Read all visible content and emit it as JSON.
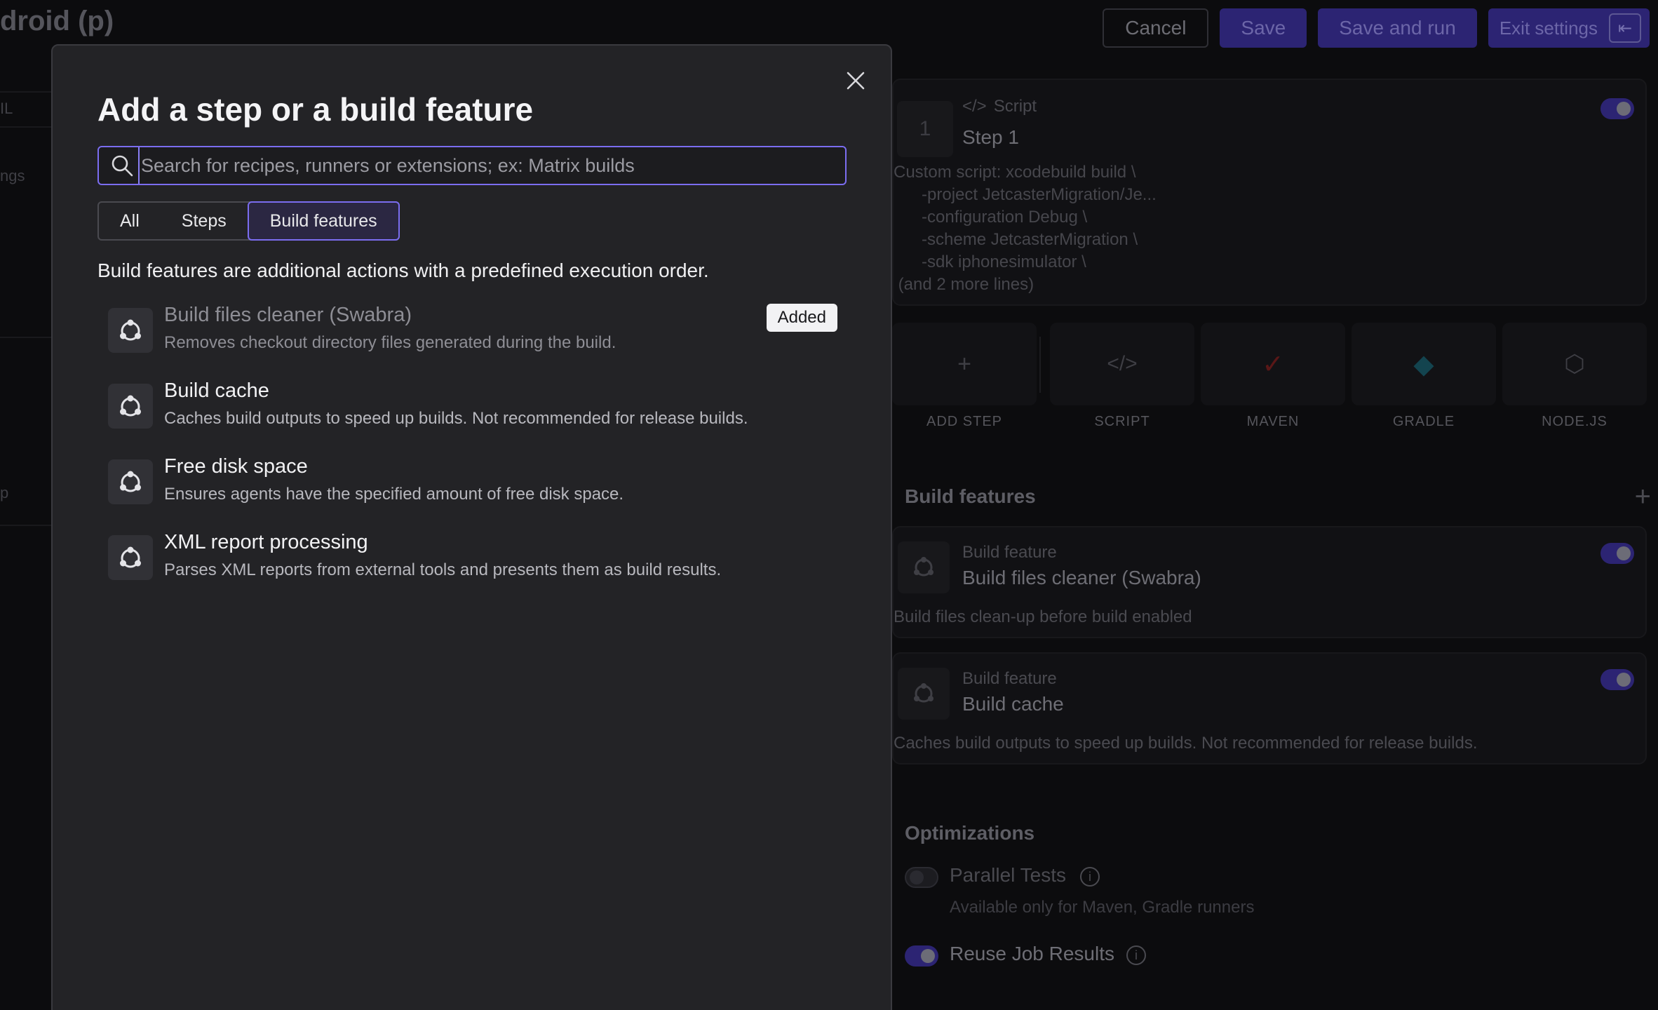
{
  "page": {
    "title": "droid (p)",
    "actions": {
      "cancel": "Cancel",
      "save": "Save",
      "save_and_run": "Save and run",
      "exit_settings": "Exit settings"
    },
    "left_fragments": [
      "IL",
      "ngs",
      "p"
    ]
  },
  "steps": {
    "step1": {
      "number": "1",
      "type": "Script",
      "name": "Step 1",
      "script_preview": "Custom script: xcodebuild build \\\n      -project JetcasterMigration/Je...\n      -configuration Debug \\\n      -scheme JetcasterMigration \\\n      -sdk iphonesimulator \\\n (and 2 more lines)"
    },
    "runners": [
      {
        "label": "ADD STEP",
        "icon": "plus-icon"
      },
      {
        "label": "SCRIPT",
        "icon": "code-icon"
      },
      {
        "label": "MAVEN",
        "icon": "maven-icon"
      },
      {
        "label": "GRADLE",
        "icon": "gradle-icon"
      },
      {
        "label": "NODE.JS",
        "icon": "nodejs-icon"
      }
    ]
  },
  "build_features_section": {
    "heading": "Build features",
    "items": [
      {
        "type": "Build feature",
        "name": "Build files cleaner (Swabra)",
        "summary": "Build files clean-up before build enabled"
      },
      {
        "type": "Build feature",
        "name": "Build cache",
        "summary": "Caches build outputs to speed up builds. Not recommended for release builds."
      }
    ]
  },
  "optimizations": {
    "heading": "Optimizations",
    "parallel_tests": {
      "label": "Parallel Tests",
      "note": "Available only for Maven, Gradle runners",
      "enabled": false
    },
    "reuse_job_results": {
      "label": "Reuse Job Results",
      "enabled": true
    }
  },
  "modal": {
    "title": "Add a step or a build feature",
    "search_placeholder": "Search for recipes, runners or extensions; ex: Matrix builds",
    "search_value": "",
    "tabs": [
      {
        "label": "All",
        "active": false
      },
      {
        "label": "Steps",
        "active": false
      },
      {
        "label": "Build features",
        "active": true
      }
    ],
    "description": "Build features are additional actions with a predefined execution order.",
    "features": [
      {
        "title": "Build files cleaner (Swabra)",
        "description": "Removes checkout directory files generated during the build.",
        "added": true,
        "badge": "Added"
      },
      {
        "title": "Build cache",
        "description": "Caches build outputs to speed up builds. Not recommended for release builds.",
        "added": false
      },
      {
        "title": "Free disk space",
        "description": "Ensures agents have the specified amount of free disk space.",
        "added": false
      },
      {
        "title": "XML report processing",
        "description": "Parses XML reports from external tools and presents them as build results.",
        "added": false
      }
    ]
  },
  "colors": {
    "accent": "#7b6df0",
    "toggle_on": "#2c2473",
    "modal_bg": "#232326",
    "page_bg": "#0c0c0e"
  }
}
